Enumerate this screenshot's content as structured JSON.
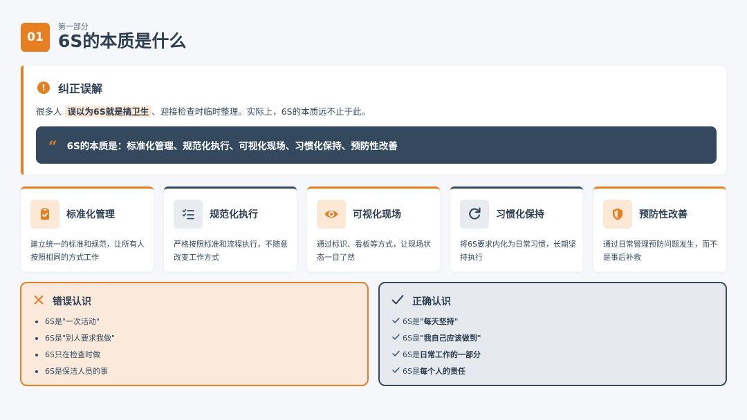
{
  "header": {
    "number": "01",
    "subtitle": "第一部分",
    "title": "6S的本质是什么"
  },
  "correction": {
    "title": "纠正误解",
    "text_before": "很多人",
    "text_highlight": "误以为6S就是搞卫生",
    "text_after": "、迎接检查时临时整理。实际上，6S的本质远不止于此。",
    "quote": "6S的本质是：标准化管理、规范化执行、可视化现场、习惯化保持、预防性改善"
  },
  "cards": [
    {
      "title": "标准化管理",
      "desc": "建立统一的标准和规范，让所有人按照相同的方式工作",
      "icon": "clipboard-check-icon"
    },
    {
      "title": "规范化执行",
      "desc": "严格按照标准和流程执行，不随意改变工作方式",
      "icon": "checklist-icon"
    },
    {
      "title": "可视化现场",
      "desc": "通过标识、看板等方式，让现场状态一目了然",
      "icon": "eye-icon"
    },
    {
      "title": "习惯化保持",
      "desc": "将6S要求内化为日常习惯，长期坚持执行",
      "icon": "redo-icon"
    },
    {
      "title": "预防性改善",
      "desc": "通过日常管理预防问题发生，而不是事后补救",
      "icon": "shield-icon"
    }
  ],
  "wrong": {
    "title": "错误认识",
    "items": [
      "6S是\"一次活动\"",
      "6S是\"别人要求我做\"",
      "6S只在检查时做",
      "6S是保洁人员的事"
    ]
  },
  "right": {
    "title": "正确认识",
    "items": [
      {
        "prefix": "6S是",
        "bold": "\"每天坚持\""
      },
      {
        "prefix": "6S是",
        "bold": "\"我自己应该做到\""
      },
      {
        "prefix": "6S是",
        "bold": "日常工作的一部分"
      },
      {
        "prefix": "6S是",
        "bold": "每个人的责任"
      }
    ]
  },
  "colors": {
    "accent": "#e67e22",
    "dark": "#34495e",
    "background": "#f5f7fa"
  }
}
